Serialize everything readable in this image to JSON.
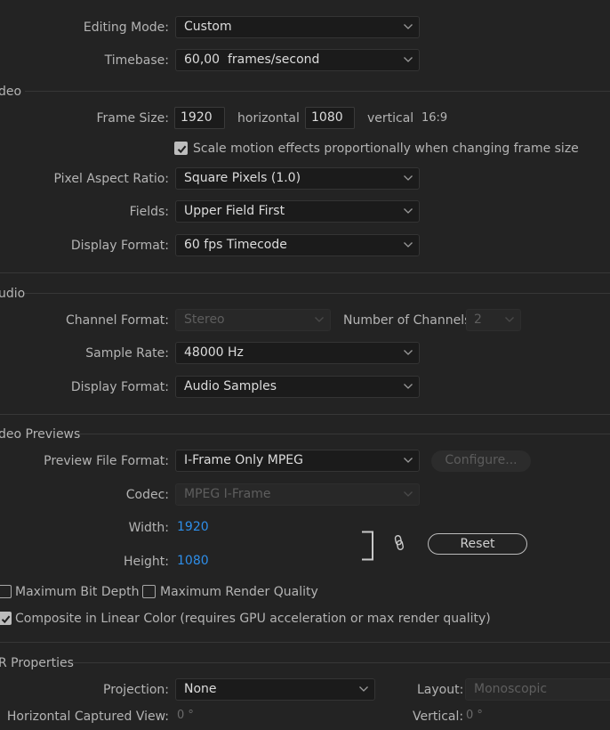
{
  "general": {
    "editing_mode_label": "Editing Mode:",
    "editing_mode_value": "Custom",
    "timebase_label": "Timebase:",
    "timebase_value": "60,00  frames/second"
  },
  "video": {
    "section_title": "deo",
    "frame_size_label": "Frame Size:",
    "frame_width": "1920",
    "horizontal_label": "horizontal",
    "frame_height": "1080",
    "vertical_label": "vertical",
    "aspect_label": "16:9",
    "scale_motion_label": "Scale motion effects proportionally when changing frame size",
    "scale_motion_checked": true,
    "pixel_aspect_label": "Pixel Aspect Ratio:",
    "pixel_aspect_value": "Square Pixels (1.0)",
    "fields_label": "Fields:",
    "fields_value": "Upper Field First",
    "display_format_label": "Display Format:",
    "display_format_value": "60 fps Timecode"
  },
  "audio": {
    "section_title": "udio",
    "channel_format_label": "Channel Format:",
    "channel_format_value": "Stereo",
    "num_channels_label": "Number of Channels:",
    "num_channels_value": "2",
    "sample_rate_label": "Sample Rate:",
    "sample_rate_value": "48000 Hz",
    "display_format_label": "Display Format:",
    "display_format_value": "Audio Samples"
  },
  "previews": {
    "section_title": "deo Previews",
    "preview_format_label": "Preview File Format:",
    "preview_format_value": "I-Frame Only MPEG",
    "configure_label": "Configure...",
    "codec_label": "Codec:",
    "codec_value": "MPEG I-Frame",
    "width_label": "Width:",
    "width_value": "1920",
    "height_label": "Height:",
    "height_value": "1080",
    "reset_label": "Reset",
    "max_bit_depth_label": "Maximum Bit Depth",
    "max_render_quality_label": "Maximum Render Quality",
    "composite_linear_label": "Composite in Linear Color (requires GPU acceleration or max render quality)"
  },
  "vr": {
    "section_title": "R Properties",
    "projection_label": "Projection:",
    "projection_value": "None",
    "layout_label": "Layout:",
    "layout_value": "Monoscopic",
    "h_captured_label": "Horizontal Captured View:",
    "h_captured_value": "0 °",
    "vertical_label": "Vertical:",
    "vertical_value": "0 °"
  },
  "colors": {
    "background": "#232323",
    "field": "#1b1b1b",
    "accent_blue": "#2e8ee9",
    "label": "#b4b4b4"
  },
  "icons": [
    "chevron-down-icon",
    "checkmark-icon",
    "link-icon",
    "bracket-icon"
  ]
}
